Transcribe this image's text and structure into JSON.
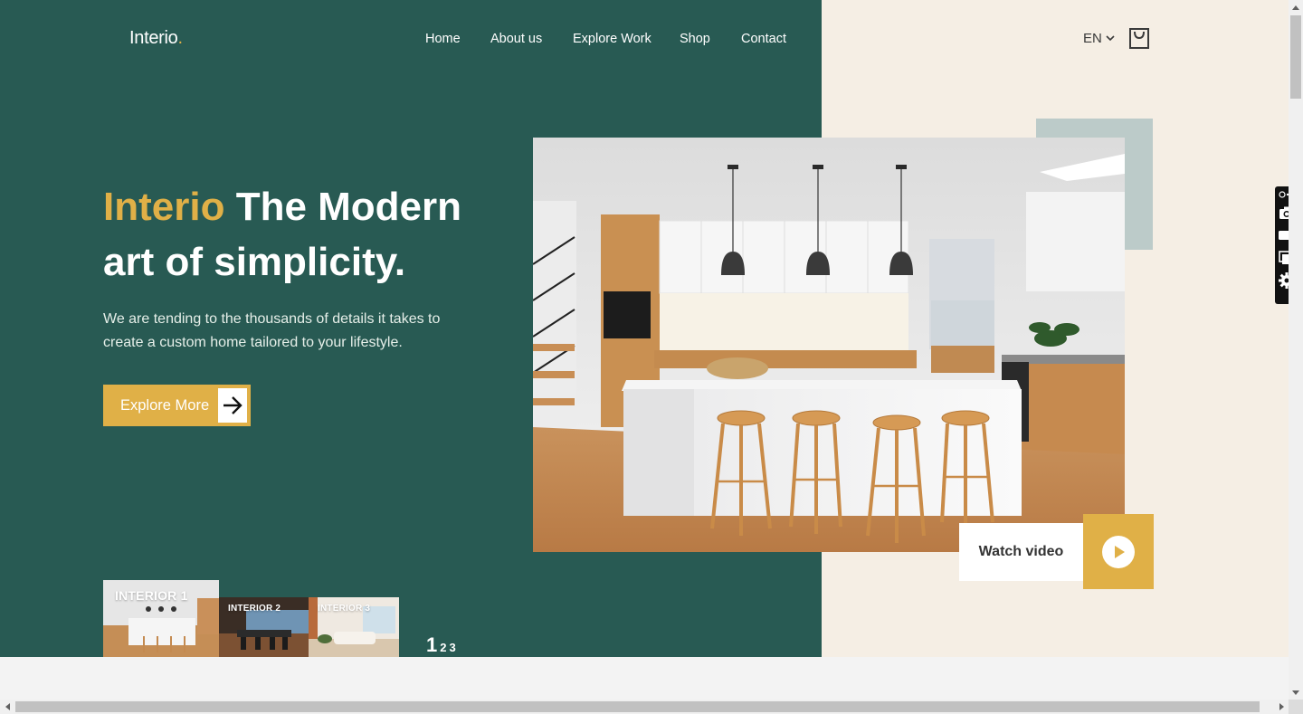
{
  "brand": {
    "name": "Interio",
    "dot": "."
  },
  "nav": {
    "items": [
      {
        "label": "Home"
      },
      {
        "label": "About us"
      },
      {
        "label": "Explore Work"
      },
      {
        "label": "Shop"
      },
      {
        "label": "Contact"
      }
    ]
  },
  "header": {
    "language": "EN",
    "cart_icon": "shopping-bag-icon"
  },
  "hero": {
    "title_brand": "Interio",
    "title_rest": "The Modern art of simplicity.",
    "description": "We are tending to the thousands of details it takes to create a custom home tailored to your lifestyle.",
    "cta_label": "Explore More",
    "watch_label": "Watch video"
  },
  "thumbnails": [
    {
      "label": "INTERIOR 1"
    },
    {
      "label": "INTERIOR 2"
    },
    {
      "label": "INTERIOR 3"
    }
  ],
  "pager": {
    "active": "1",
    "others": [
      "2",
      "3"
    ]
  },
  "colors": {
    "green": "#285a53",
    "gold": "#e0b047",
    "cream": "#f5eee4",
    "sage": "#bccbc9"
  }
}
